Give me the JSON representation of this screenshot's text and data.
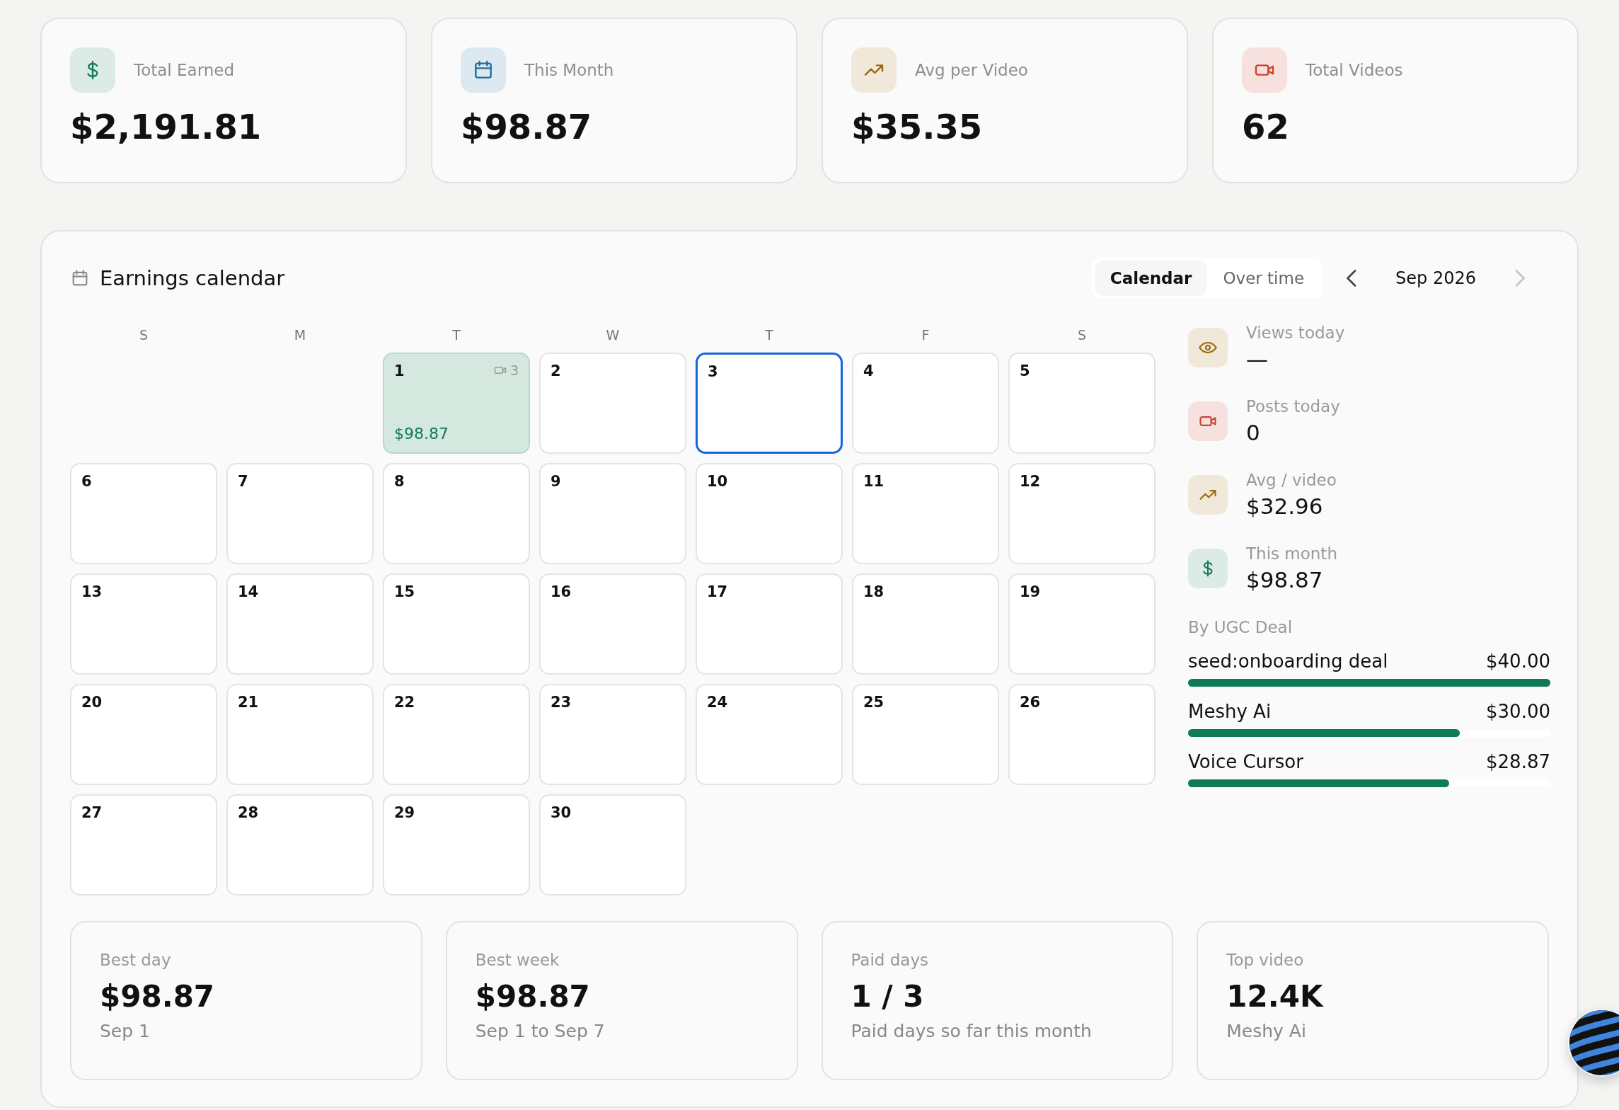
{
  "summary_cards": [
    {
      "kind": "dollar",
      "label": "Total Earned",
      "value": "$2,191.81"
    },
    {
      "kind": "calendar",
      "label": "This Month",
      "value": "$98.87"
    },
    {
      "kind": "trend",
      "label": "Avg per Video",
      "value": "$35.35"
    },
    {
      "kind": "video",
      "label": "Total Videos",
      "value": "62"
    }
  ],
  "calendar_panel": {
    "title": "Earnings calendar",
    "tabs": [
      {
        "label": "Calendar",
        "selected": true
      },
      {
        "label": "Over time",
        "selected": false
      }
    ],
    "month_nav": {
      "label": "Sep 2026",
      "prev_disabled": false,
      "next_disabled": true
    },
    "weekdays": [
      "S",
      "M",
      "T",
      "W",
      "T",
      "F",
      "S"
    ],
    "days": [
      {
        "kind": "blank"
      },
      {
        "kind": "blank"
      },
      {
        "kind": "day",
        "label": "1",
        "paid": true,
        "videos": "3",
        "amount": "$98.87",
        "selected": false
      },
      {
        "kind": "day",
        "label": "2",
        "paid": false,
        "selected": false
      },
      {
        "kind": "day",
        "label": "3",
        "paid": false,
        "selected": true
      },
      {
        "kind": "day",
        "label": "4",
        "paid": false,
        "selected": false
      },
      {
        "kind": "day",
        "label": "5",
        "paid": false,
        "selected": false
      },
      {
        "kind": "day",
        "label": "6",
        "paid": false,
        "selected": false
      },
      {
        "kind": "day",
        "label": "7",
        "paid": false,
        "selected": false
      },
      {
        "kind": "day",
        "label": "8",
        "paid": false,
        "selected": false
      },
      {
        "kind": "day",
        "label": "9",
        "paid": false,
        "selected": false
      },
      {
        "kind": "day",
        "label": "10",
        "paid": false,
        "selected": false
      },
      {
        "kind": "day",
        "label": "11",
        "paid": false,
        "selected": false
      },
      {
        "kind": "day",
        "label": "12",
        "paid": false,
        "selected": false
      },
      {
        "kind": "day",
        "label": "13",
        "paid": false,
        "selected": false
      },
      {
        "kind": "day",
        "label": "14",
        "paid": false,
        "selected": false
      },
      {
        "kind": "day",
        "label": "15",
        "paid": false,
        "selected": false
      },
      {
        "kind": "day",
        "label": "16",
        "paid": false,
        "selected": false
      },
      {
        "kind": "day",
        "label": "17",
        "paid": false,
        "selected": false
      },
      {
        "kind": "day",
        "label": "18",
        "paid": false,
        "selected": false
      },
      {
        "kind": "day",
        "label": "19",
        "paid": false,
        "selected": false
      },
      {
        "kind": "day",
        "label": "20",
        "paid": false,
        "selected": false
      },
      {
        "kind": "day",
        "label": "21",
        "paid": false,
        "selected": false
      },
      {
        "kind": "day",
        "label": "22",
        "paid": false,
        "selected": false
      },
      {
        "kind": "day",
        "label": "23",
        "paid": false,
        "selected": false
      },
      {
        "kind": "day",
        "label": "24",
        "paid": false,
        "selected": false
      },
      {
        "kind": "day",
        "label": "25",
        "paid": false,
        "selected": false
      },
      {
        "kind": "day",
        "label": "26",
        "paid": false,
        "selected": false
      },
      {
        "kind": "day",
        "label": "27",
        "paid": false,
        "selected": false
      },
      {
        "kind": "day",
        "label": "28",
        "paid": false,
        "selected": false
      },
      {
        "kind": "day",
        "label": "29",
        "paid": false,
        "selected": false
      },
      {
        "kind": "day",
        "label": "30",
        "paid": false,
        "selected": false
      }
    ],
    "side_stats": [
      {
        "kind": "eye",
        "label": "Views today",
        "value": "—"
      },
      {
        "kind": "video",
        "label": "Posts today",
        "value": "0"
      },
      {
        "kind": "trend",
        "label": "Avg / video",
        "value": "$32.96"
      },
      {
        "kind": "dollar",
        "label": "This month",
        "value": "$98.87"
      }
    ],
    "deals_title": "By UGC Deal",
    "deals": [
      {
        "name": "seed:onboarding deal",
        "amount": "$40.00",
        "level": 1.0
      },
      {
        "name": "Meshy Ai",
        "amount": "$30.00",
        "level": 0.75
      },
      {
        "name": "Voice Cursor",
        "amount": "$28.87",
        "level": 0.72
      }
    ],
    "bottom_cards": [
      {
        "label": "Best day",
        "value": "$98.87",
        "note": "Sep 1"
      },
      {
        "label": "Best week",
        "value": "$98.87",
        "note": "Sep 1 to Sep 7"
      },
      {
        "label": "Paid days",
        "value": "1 / 3",
        "note": "Paid days so far this month"
      },
      {
        "label": "Top video",
        "value": "12.4K",
        "note": "Meshy Ai"
      }
    ]
  }
}
